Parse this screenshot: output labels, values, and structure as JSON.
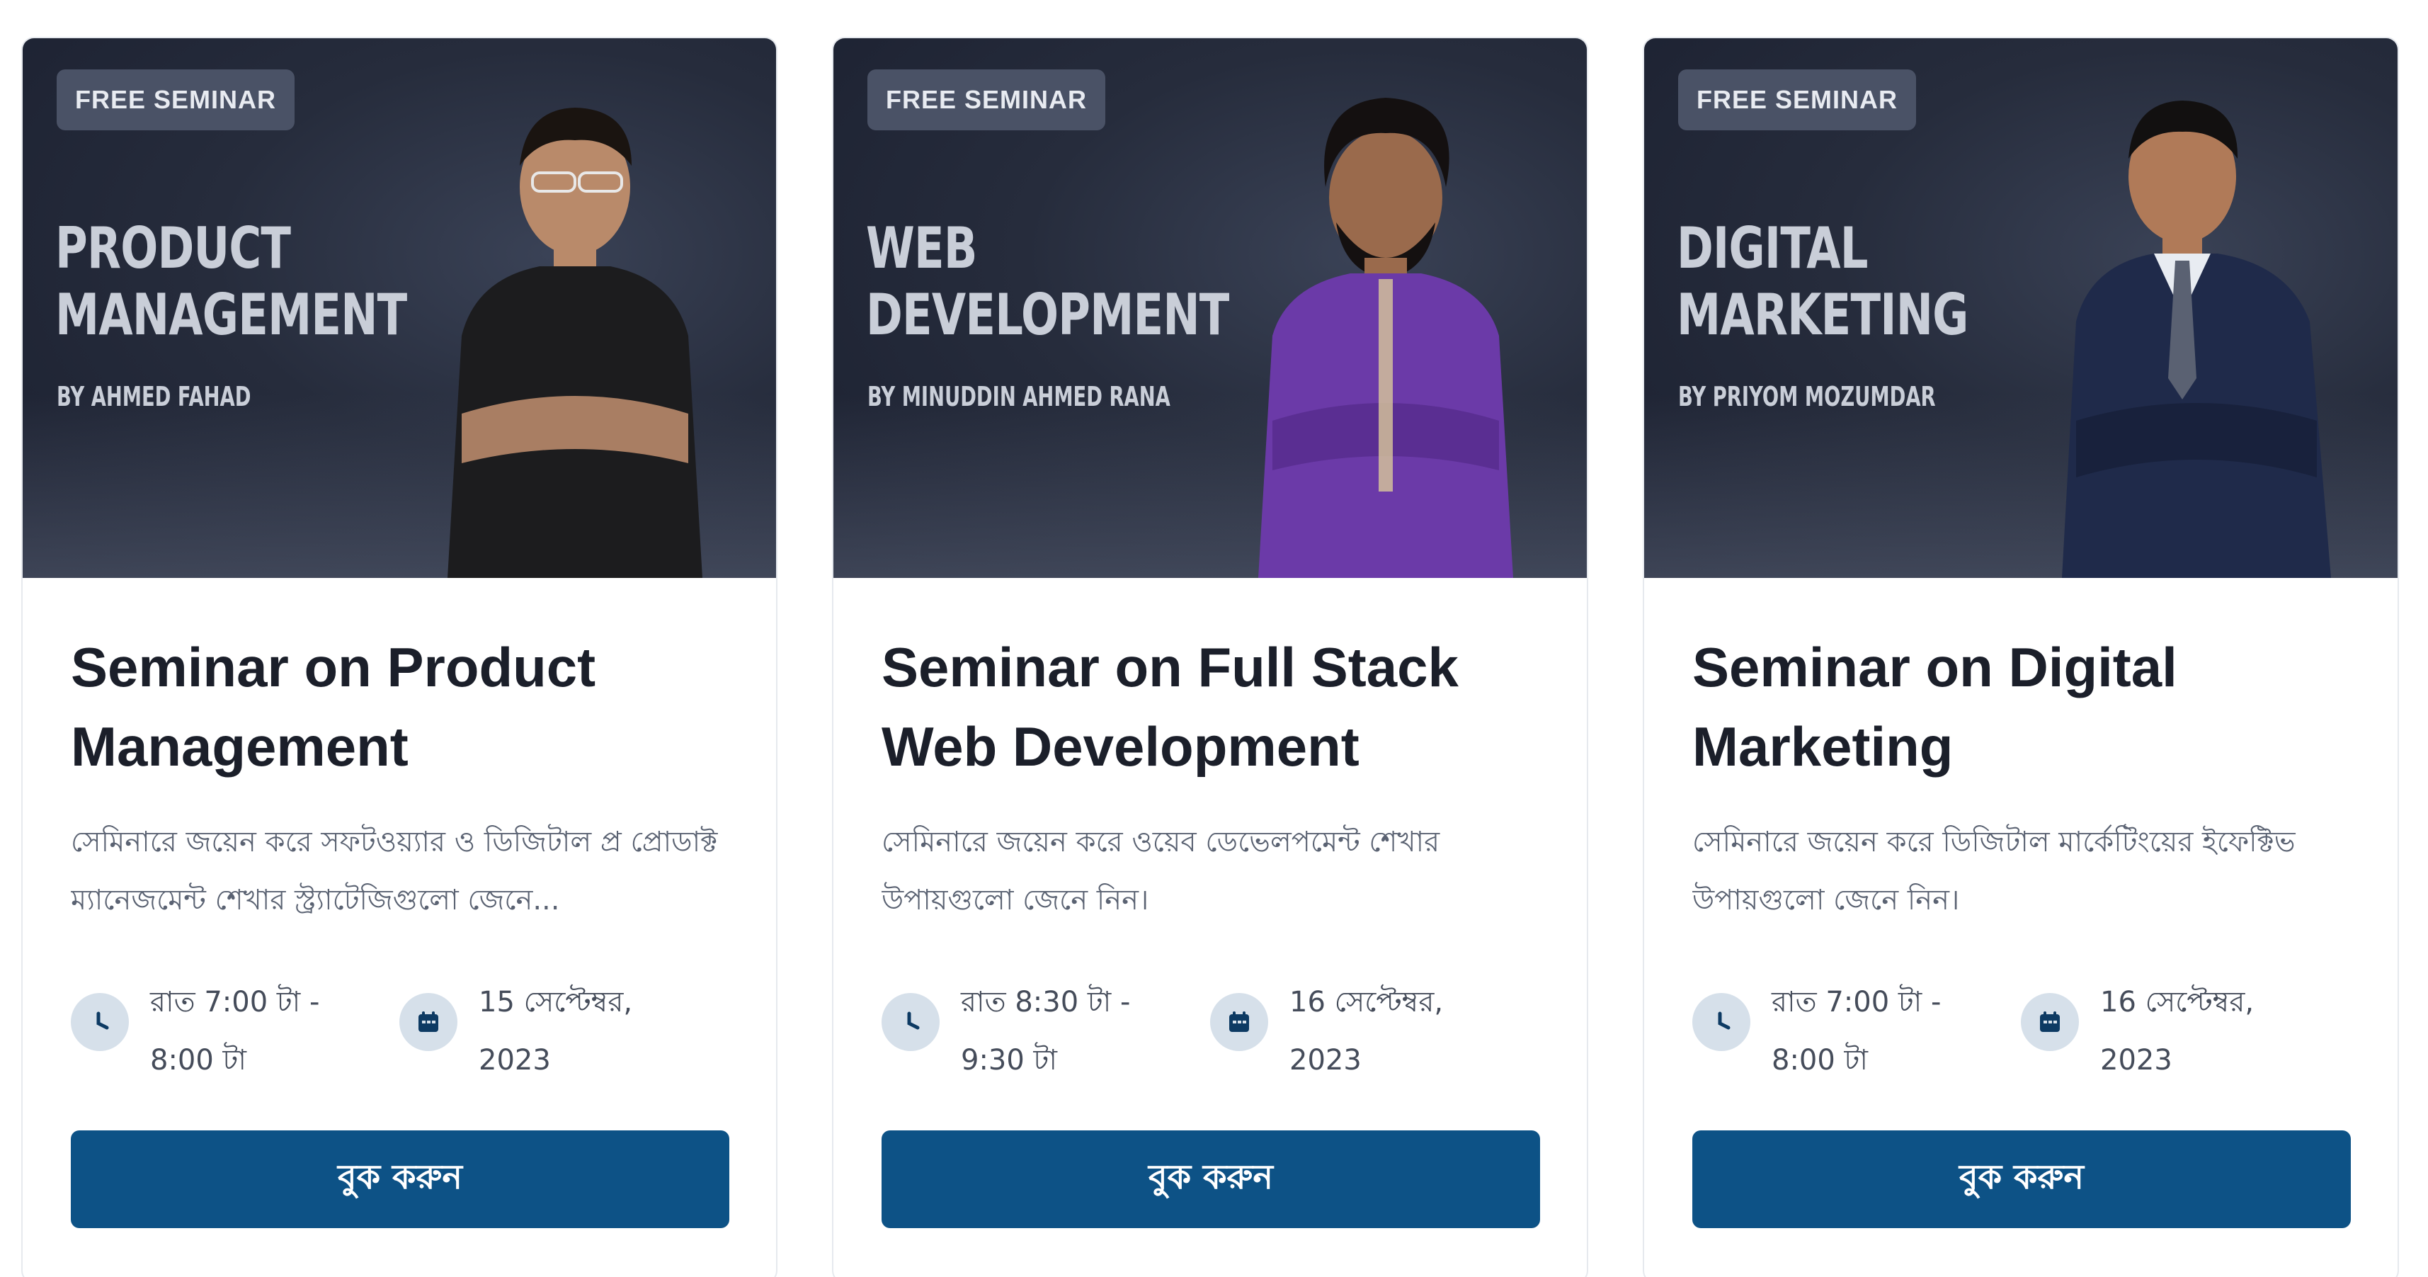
{
  "colors": {
    "accent_button": "#0d5286",
    "banner_dark": "#1b2030",
    "icon_bg": "#d6e0ea"
  },
  "cards": [
    {
      "badge": "FREE SEMINAR",
      "banner_title": "PRODUCT\nMANAGEMENT",
      "banner_by": "BY AHMED FAHAD",
      "shirt_color": "#1c1c1e",
      "title": "Seminar on Product Management",
      "description": "সেমিনারে জয়েন করে সফটওয়্যার ও ডিজিটাল প্র প্রোডাক্ট ম্যানেজমেন্ট শেখার স্ট্র্যাটেজিগুলো জেনে...",
      "time": "রাত 7:00 টা - 8:00 টা",
      "date": "15 সেপ্টেম্বর, 2023",
      "time_icon": "clock-icon",
      "date_icon": "calendar-icon",
      "button": "বুক করুন"
    },
    {
      "badge": "FREE SEMINAR",
      "banner_title": "WEB\nDEVELOPMENT",
      "banner_by": "BY MINUDDIN AHMED RANA",
      "shirt_color": "#6b3aa8",
      "title": "Seminar on Full Stack Web Development",
      "description": "সেমিনারে জয়েন করে ওয়েব ডেভেলপমেন্ট শেখার উপায়গুলো জেনে নিন।",
      "time": "রাত 8:30 টা - 9:30 টা",
      "date": "16 সেপ্টেম্বর, 2023",
      "time_icon": "clock-icon",
      "date_icon": "calendar-icon",
      "button": "বুক করুন"
    },
    {
      "badge": "FREE SEMINAR",
      "banner_title": "DIGITAL\nMARKETING",
      "banner_by": "BY PRIYOM MOZUMDAR",
      "shirt_color": "#1f2a4a",
      "title": "Seminar on Digital Marketing",
      "description": "সেমিনারে জয়েন করে ডিজিটাল মার্কেটিংয়ের ইফেক্টিভ উপায়গুলো জেনে নিন।",
      "time": "রাত 7:00 টা - 8:00 টা",
      "date": "16 সেপ্টেম্বর, 2023",
      "time_icon": "clock-icon",
      "date_icon": "calendar-icon",
      "button": "বুক করুন"
    }
  ]
}
